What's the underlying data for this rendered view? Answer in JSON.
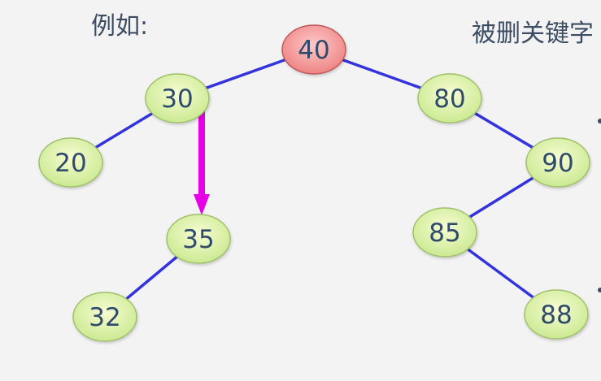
{
  "labels": {
    "example": "例如:",
    "deleted_key": "被删关键字"
  },
  "colors": {
    "background": "#f3f3f3",
    "edge": "#3333dd",
    "node_fill_inner": "#f7fcd2",
    "node_fill_outer": "#c7e88d",
    "node_stroke": "#9fc06a",
    "root_fill_inner": "#ffc9c9",
    "root_fill_outer": "#ec7e7e",
    "root_stroke": "#c05656",
    "node_text": "#2f4a6a",
    "arrow": "#e600e6"
  },
  "tree": {
    "nodes": [
      {
        "id": "n40",
        "value": "40",
        "root": true
      },
      {
        "id": "n30",
        "value": "30"
      },
      {
        "id": "n80",
        "value": "80"
      },
      {
        "id": "n20",
        "value": "20"
      },
      {
        "id": "n35",
        "value": "35"
      },
      {
        "id": "n90",
        "value": "90"
      },
      {
        "id": "n32",
        "value": "32"
      },
      {
        "id": "n85",
        "value": "85"
      },
      {
        "id": "n88",
        "value": "88"
      }
    ],
    "edges": [
      {
        "from": "n40",
        "to": "n30"
      },
      {
        "from": "n40",
        "to": "n80"
      },
      {
        "from": "n30",
        "to": "n20"
      },
      {
        "from": "n80",
        "to": "n90"
      },
      {
        "from": "n35",
        "to": "n32"
      },
      {
        "from": "n90",
        "to": "n85"
      },
      {
        "from": "n85",
        "to": "n88"
      }
    ],
    "replacement_arrow": {
      "from": "n30",
      "to": "n35"
    }
  }
}
